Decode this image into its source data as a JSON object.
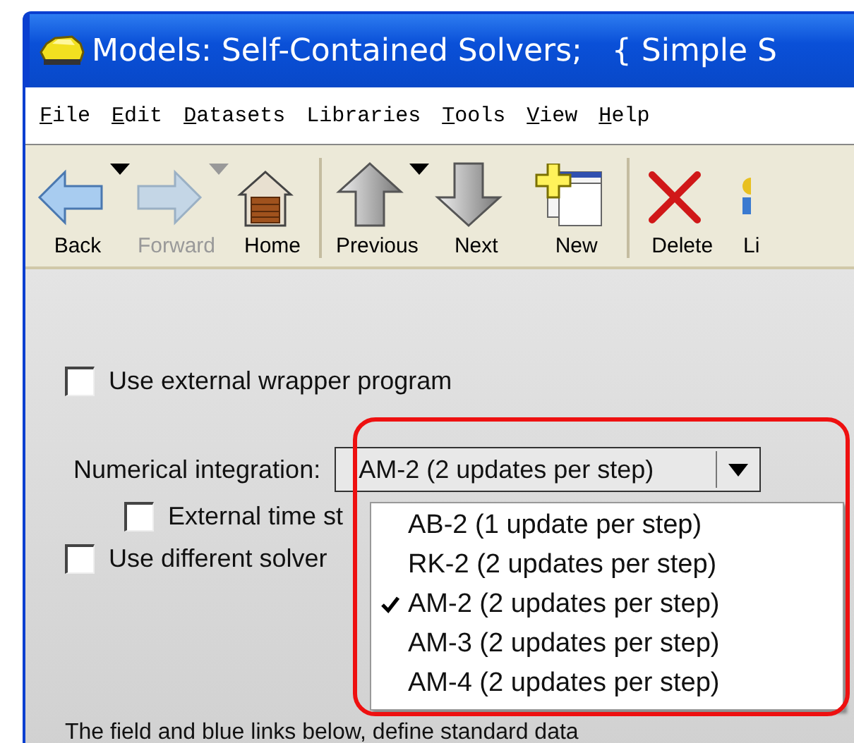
{
  "window": {
    "title": "Models: Self-Contained Solvers;   { Simple S"
  },
  "menu": [
    {
      "label": "File",
      "mnemonic": true
    },
    {
      "label": "Edit",
      "mnemonic": true
    },
    {
      "label": "Datasets",
      "mnemonic": true
    },
    {
      "label": "Libraries",
      "mnemonic": false
    },
    {
      "label": "Tools",
      "mnemonic": true
    },
    {
      "label": "View",
      "mnemonic": true
    },
    {
      "label": "Help",
      "mnemonic": true
    }
  ],
  "toolbar": [
    {
      "kind": "back",
      "label": "Back",
      "disabled": false,
      "dropdown": true,
      "group_end": false
    },
    {
      "kind": "forward",
      "label": "Forward",
      "disabled": true,
      "dropdown": true,
      "group_end": false
    },
    {
      "kind": "home",
      "label": "Home",
      "disabled": false,
      "dropdown": false,
      "group_end": true
    },
    {
      "kind": "previous",
      "label": "Previous",
      "disabled": false,
      "dropdown": true,
      "group_end": false
    },
    {
      "kind": "next",
      "label": "Next",
      "disabled": false,
      "dropdown": false,
      "group_end": false
    },
    {
      "kind": "new",
      "label": "New",
      "disabled": false,
      "dropdown": false,
      "group_end": true
    },
    {
      "kind": "delete",
      "label": "Delete",
      "disabled": false,
      "dropdown": false,
      "group_end": false
    },
    {
      "kind": "partial",
      "label": "Li",
      "disabled": false,
      "dropdown": false,
      "group_end": false
    }
  ],
  "wrapper_option": {
    "label": "Use external wrapper program",
    "checked": false
  },
  "integration": {
    "label": "Numerical integration:",
    "value": "AM-2 (2 updates per step)",
    "options": [
      {
        "label": "AB-2 (1 update per step)",
        "selected": false
      },
      {
        "label": "RK-2 (2 updates per step)",
        "selected": false
      },
      {
        "label": "AM-2 (2 updates per step)",
        "selected": true
      },
      {
        "label": "AM-3 (2 updates per step)",
        "selected": false
      },
      {
        "label": "AM-4 (2 updates per step)",
        "selected": false
      }
    ]
  },
  "time_step_option": {
    "label": "External time st",
    "checked": false
  },
  "solver_option": {
    "label": "Use different solver",
    "checked": false
  },
  "footer_text": "The field and blue links below, define standard data",
  "highlight": {
    "shown": true
  }
}
